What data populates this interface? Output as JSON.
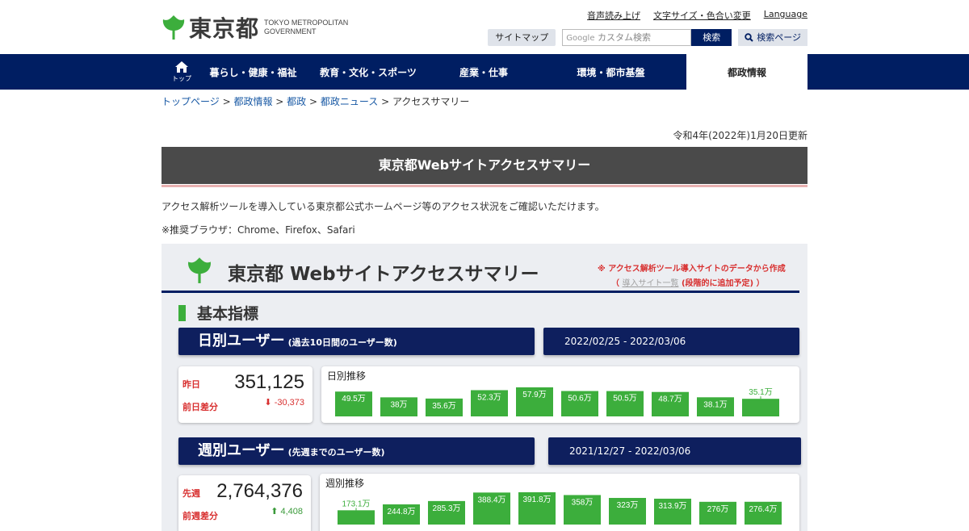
{
  "header": {
    "logo_jp": "東京都",
    "logo_en_line1": "TOKYO METROPOLITAN",
    "logo_en_line2": "GOVERNMENT",
    "util_links": [
      "音声読み上げ",
      "文字サイズ・色合い変更",
      "Language"
    ],
    "sitemap_label": "サイトマップ",
    "search_google": "Google",
    "search_placeholder": "カスタム検索",
    "search_button": "検索",
    "search_page_label": "検索ページ"
  },
  "nav": {
    "home_label": "トップ",
    "items": [
      "暮らし・健康・福祉",
      "教育・文化・スポーツ",
      "産業・仕事",
      "環境・都市基盤",
      "都政情報"
    ],
    "active_index": 4
  },
  "breadcrumb": [
    "トップページ",
    "都政情報",
    "都政",
    "都政ニュース",
    "アクセスサマリー"
  ],
  "updated": "令和4年(2022年)1月20日更新",
  "page_title": "東京都Webサイトアクセスサマリー",
  "intro": "アクセス解析ツールを導入している東京都公式ホームページ等のアクセス状況をご確認いただけます。",
  "browsers": "※推奨ブラウザ：Chrome、Firefox、Safari",
  "panel": {
    "title": "東京都 Webサイトアクセスサマリー",
    "note_line1": "※ アクセス解析ツール導入サイトのデータから作成",
    "note_open": "（ ",
    "note_link": "導入サイト一覧",
    "note_close": " (段階的に追加予定) ）",
    "section_title": "基本指標",
    "daily": {
      "title": "日別ユーザー",
      "subtitle": "(過去10日間のユーザー数)",
      "date_range": "2022/02/25 - 2022/03/06",
      "kpi_label": "昨日",
      "kpi_value": "351,125",
      "diff_label": "前日差分",
      "diff_value": "-30,373",
      "diff_arrow": "⬇",
      "chart_title": "日別推移"
    },
    "weekly": {
      "title": "週別ユーザー",
      "subtitle": "(先週までのユーザー数)",
      "date_range": "2021/12/27 - 2022/03/06",
      "kpi_label": "先週",
      "kpi_value": "2,764,376",
      "diff_label": "前週差分",
      "diff_value": "4,408",
      "diff_arrow": "⬆",
      "chart_title": "週別推移"
    }
  },
  "colors": {
    "navy": "#001e62",
    "green": "#3cae3c",
    "red": "#d83030"
  },
  "chart_data": [
    {
      "type": "bar",
      "title": "日別推移",
      "labels": [
        "49.5万",
        "38万",
        "35.6万",
        "52.3万",
        "57.9万",
        "50.6万",
        "50.5万",
        "48.7万",
        "38.1万",
        "35.1万"
      ],
      "values": [
        495000,
        380000,
        356000,
        523000,
        579000,
        506000,
        505000,
        487000,
        381000,
        351000
      ]
    },
    {
      "type": "bar",
      "title": "週別推移",
      "labels": [
        "173.1万",
        "244.8万",
        "285.3万",
        "388.4万",
        "391.8万",
        "358万",
        "323万",
        "313.9万",
        "276万",
        "276.4万"
      ],
      "values": [
        1731000,
        2448000,
        2853000,
        3884000,
        3918000,
        3580000,
        3230000,
        3139000,
        2760000,
        2764000
      ]
    }
  ]
}
